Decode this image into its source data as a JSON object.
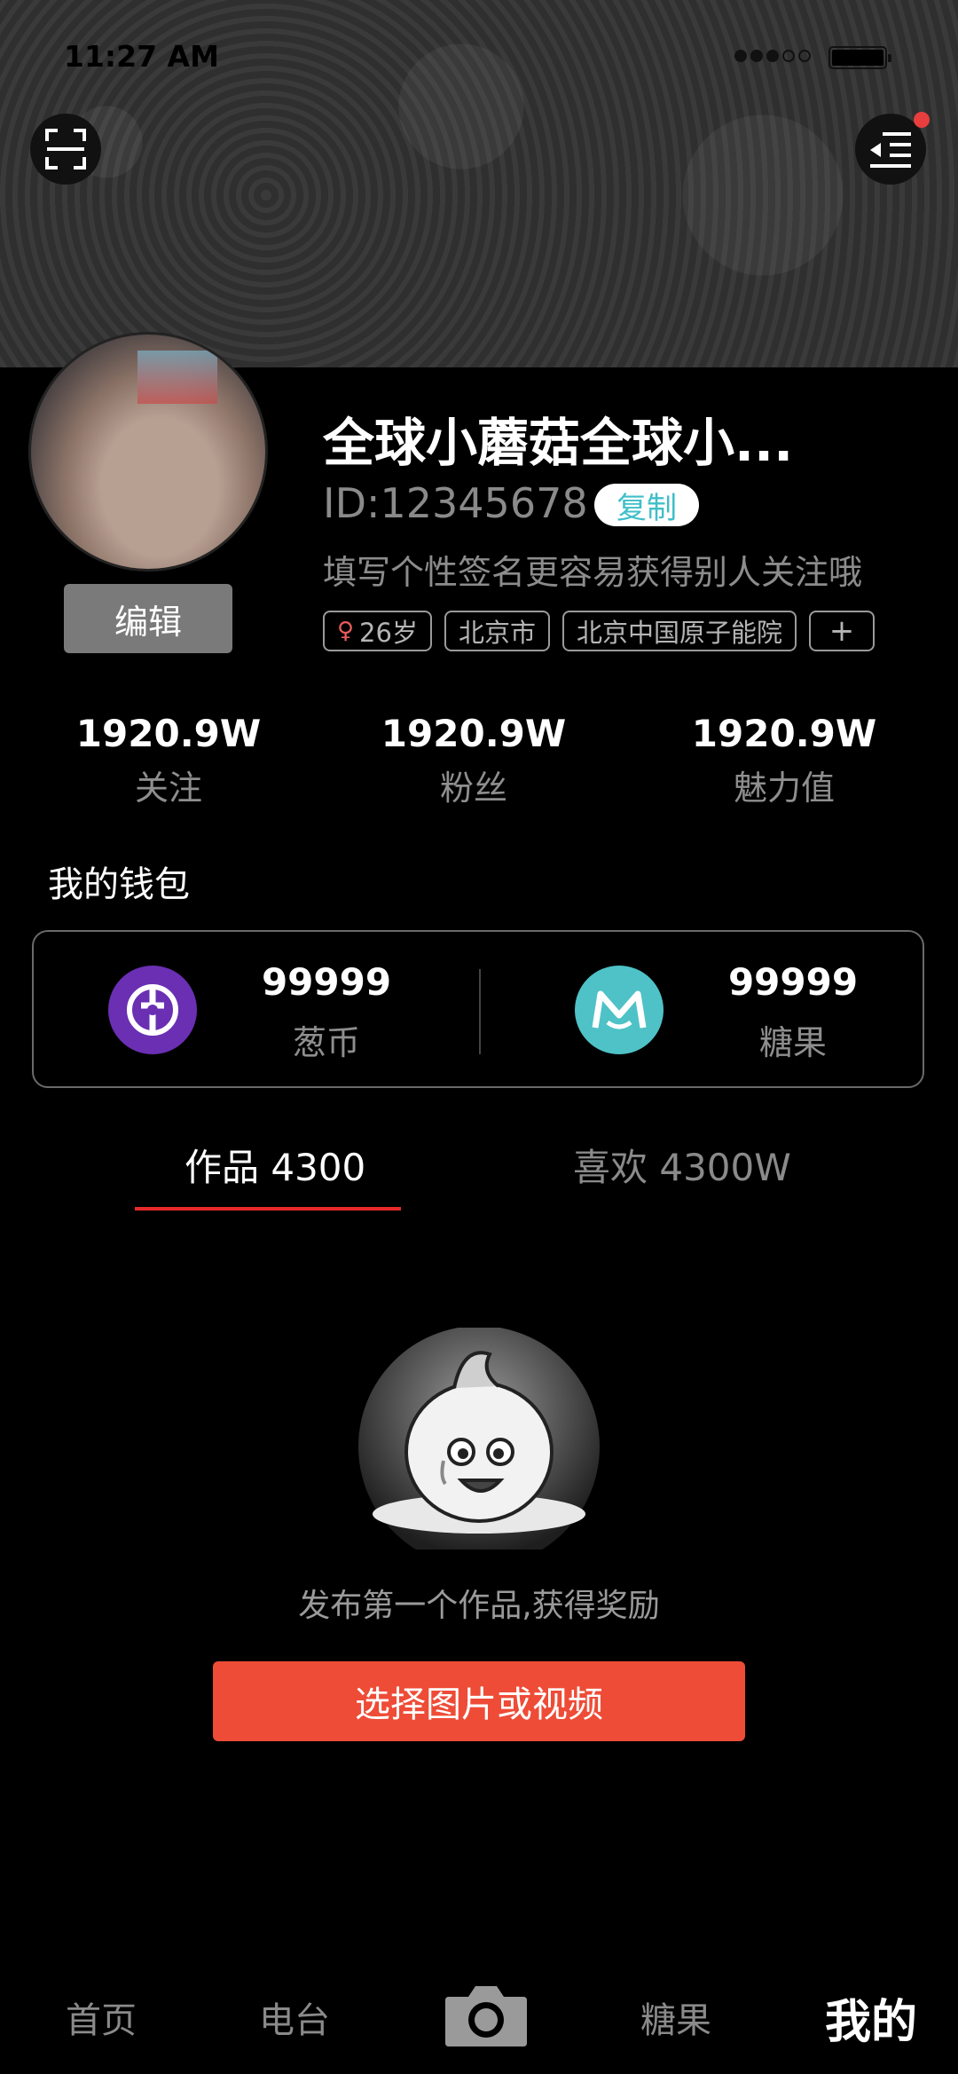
{
  "status_bar": {
    "time": "11:27 AM",
    "signal_dots_filled": 3,
    "signal_dots_total": 5
  },
  "profile": {
    "username": "全球小蘑菇全球小...",
    "id": "ID:12345678",
    "copy_label": "复制",
    "edit_label": "编辑",
    "signature": "填写个性签名更容易获得别人关注哦",
    "tags": [
      {
        "label": "26岁",
        "icon": "female-icon"
      },
      {
        "label": "北京市"
      },
      {
        "label": "北京中国原子能院"
      },
      {
        "label": "+"
      }
    ]
  },
  "stats": [
    {
      "value": "1920.9W",
      "label": "关注"
    },
    {
      "value": "1920.9W",
      "label": "粉丝"
    },
    {
      "value": "1920.9W",
      "label": "魅力值"
    }
  ],
  "wallet": {
    "title": "我的钱包",
    "items": [
      {
        "amount": "99999",
        "unit": "葱币",
        "icon": "onion-coin-icon",
        "color": "#6a2fb3"
      },
      {
        "amount": "99999",
        "unit": "糖果",
        "icon": "candy-coin-icon",
        "color": "#4ec2c7"
      }
    ]
  },
  "tabs": [
    {
      "label": "作品 4300",
      "active": true
    },
    {
      "label": "喜欢 4300W",
      "active": false
    }
  ],
  "empty_state": {
    "message": "发布第一个作品,获得奖励",
    "cta_label": "选择图片或视频"
  },
  "bottom_nav": [
    {
      "label": "首页"
    },
    {
      "label": "电台"
    },
    {
      "label": "",
      "icon": "camera-icon"
    },
    {
      "label": "糖果"
    },
    {
      "label": "我的",
      "active": true
    }
  ],
  "colors": {
    "accent_red": "#e52a2a",
    "cta": "#ee4c37",
    "teal": "#4ec2c7",
    "purple": "#6a2fb3"
  }
}
